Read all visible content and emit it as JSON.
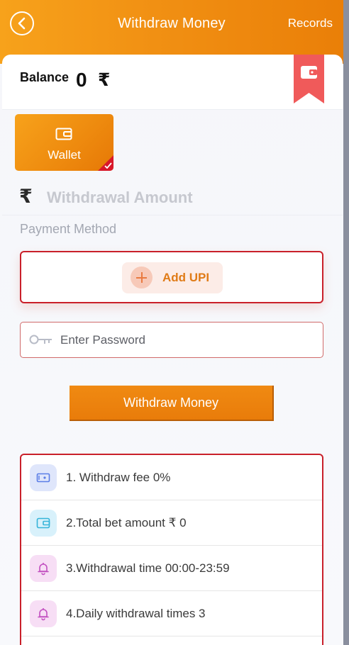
{
  "header": {
    "title": "Withdraw Money",
    "records_label": "Records"
  },
  "balance": {
    "label": "Balance",
    "value": "0",
    "currency": "₹"
  },
  "wallet_option": {
    "label": "Wallet",
    "selected": true
  },
  "amount": {
    "currency": "₹",
    "placeholder": "Withdrawal Amount"
  },
  "payment": {
    "label": "Payment Method",
    "add_upi_label": "Add UPI"
  },
  "password": {
    "placeholder": "Enter Password",
    "value": ""
  },
  "withdraw_button_label": "Withdraw Money",
  "rules": [
    {
      "text": "1. Withdraw fee 0%",
      "icon": "cash-icon"
    },
    {
      "text": "2.Total bet amount ₹ 0",
      "icon": "wallet-icon"
    },
    {
      "text": "3.Withdrawal time 00:00-23:59",
      "icon": "bell-icon"
    },
    {
      "text": "4.Daily withdrawal times 3",
      "icon": "bell-icon"
    }
  ],
  "colors": {
    "accent": "#f19013",
    "border_red": "#c9202a",
    "ribbon": "#f05a5a"
  }
}
